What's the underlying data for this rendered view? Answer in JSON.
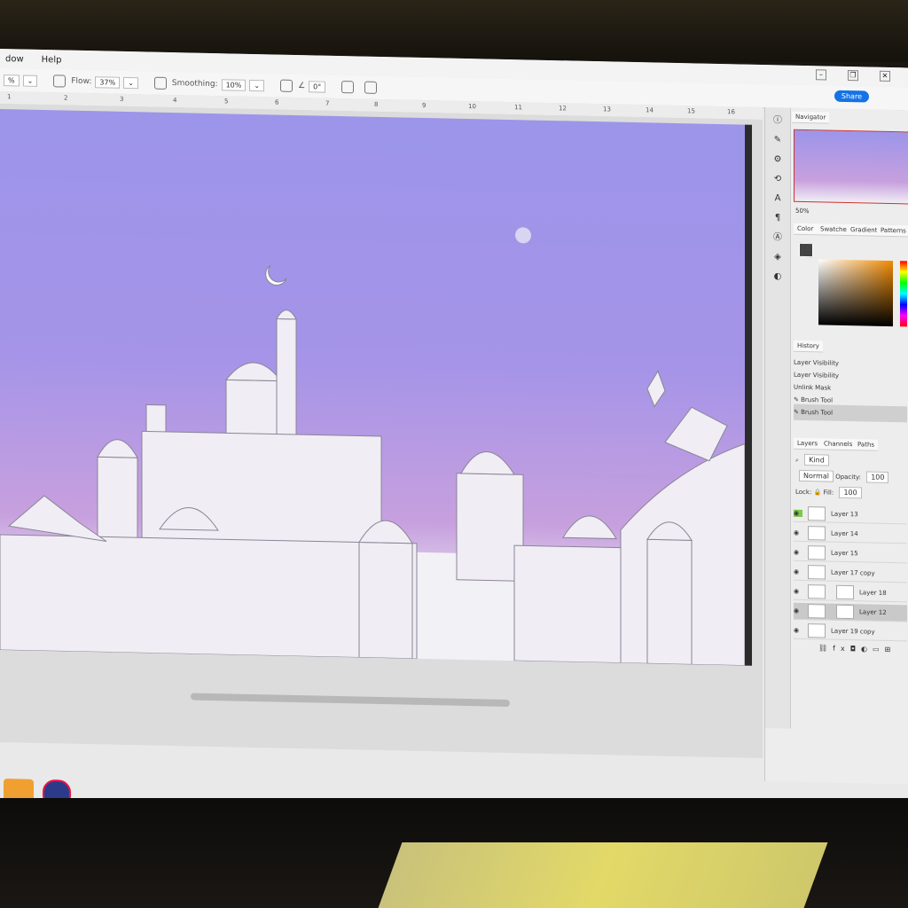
{
  "menubar": {
    "items": [
      "dow",
      "Help"
    ]
  },
  "options": {
    "size_value": "%",
    "flow_label": "Flow:",
    "flow_value": "37%",
    "smoothing_label": "Smoothing:",
    "smoothing_value": "10%",
    "angle_value": "0°"
  },
  "share_label": "Share",
  "ruler": [
    "1",
    "2",
    "3",
    "4",
    "5",
    "6",
    "7",
    "8",
    "9",
    "10",
    "11",
    "12",
    "13",
    "14",
    "15",
    "16"
  ],
  "navigator": {
    "tab": "Navigator",
    "zoom": "50%"
  },
  "color_tabs": [
    "Color",
    "Swatches",
    "Gradients",
    "Patterns"
  ],
  "history": {
    "tab": "History",
    "items": [
      "Layer Visibility",
      "Layer Visibility",
      "Unlink Mask",
      "Brush Tool",
      "Brush Tool"
    ]
  },
  "layers_tabs": [
    "Layers",
    "Channels",
    "Paths"
  ],
  "layers": {
    "kind_label": "Kind",
    "blend_mode": "Normal",
    "opacity_label": "Opacity:",
    "opacity_value": "100",
    "lock_label": "Lock:",
    "fill_label": "Fill:",
    "fill_value": "100",
    "items": [
      "Layer 13",
      "Layer 14",
      "Layer 15",
      "Layer 17 copy",
      "Layer 18",
      "Layer 12",
      "Layer 19 copy"
    ]
  },
  "colors": {
    "accent": "#1473e6",
    "sky_top": "#9c95ea",
    "sky_bottom": "#c7a0de"
  }
}
